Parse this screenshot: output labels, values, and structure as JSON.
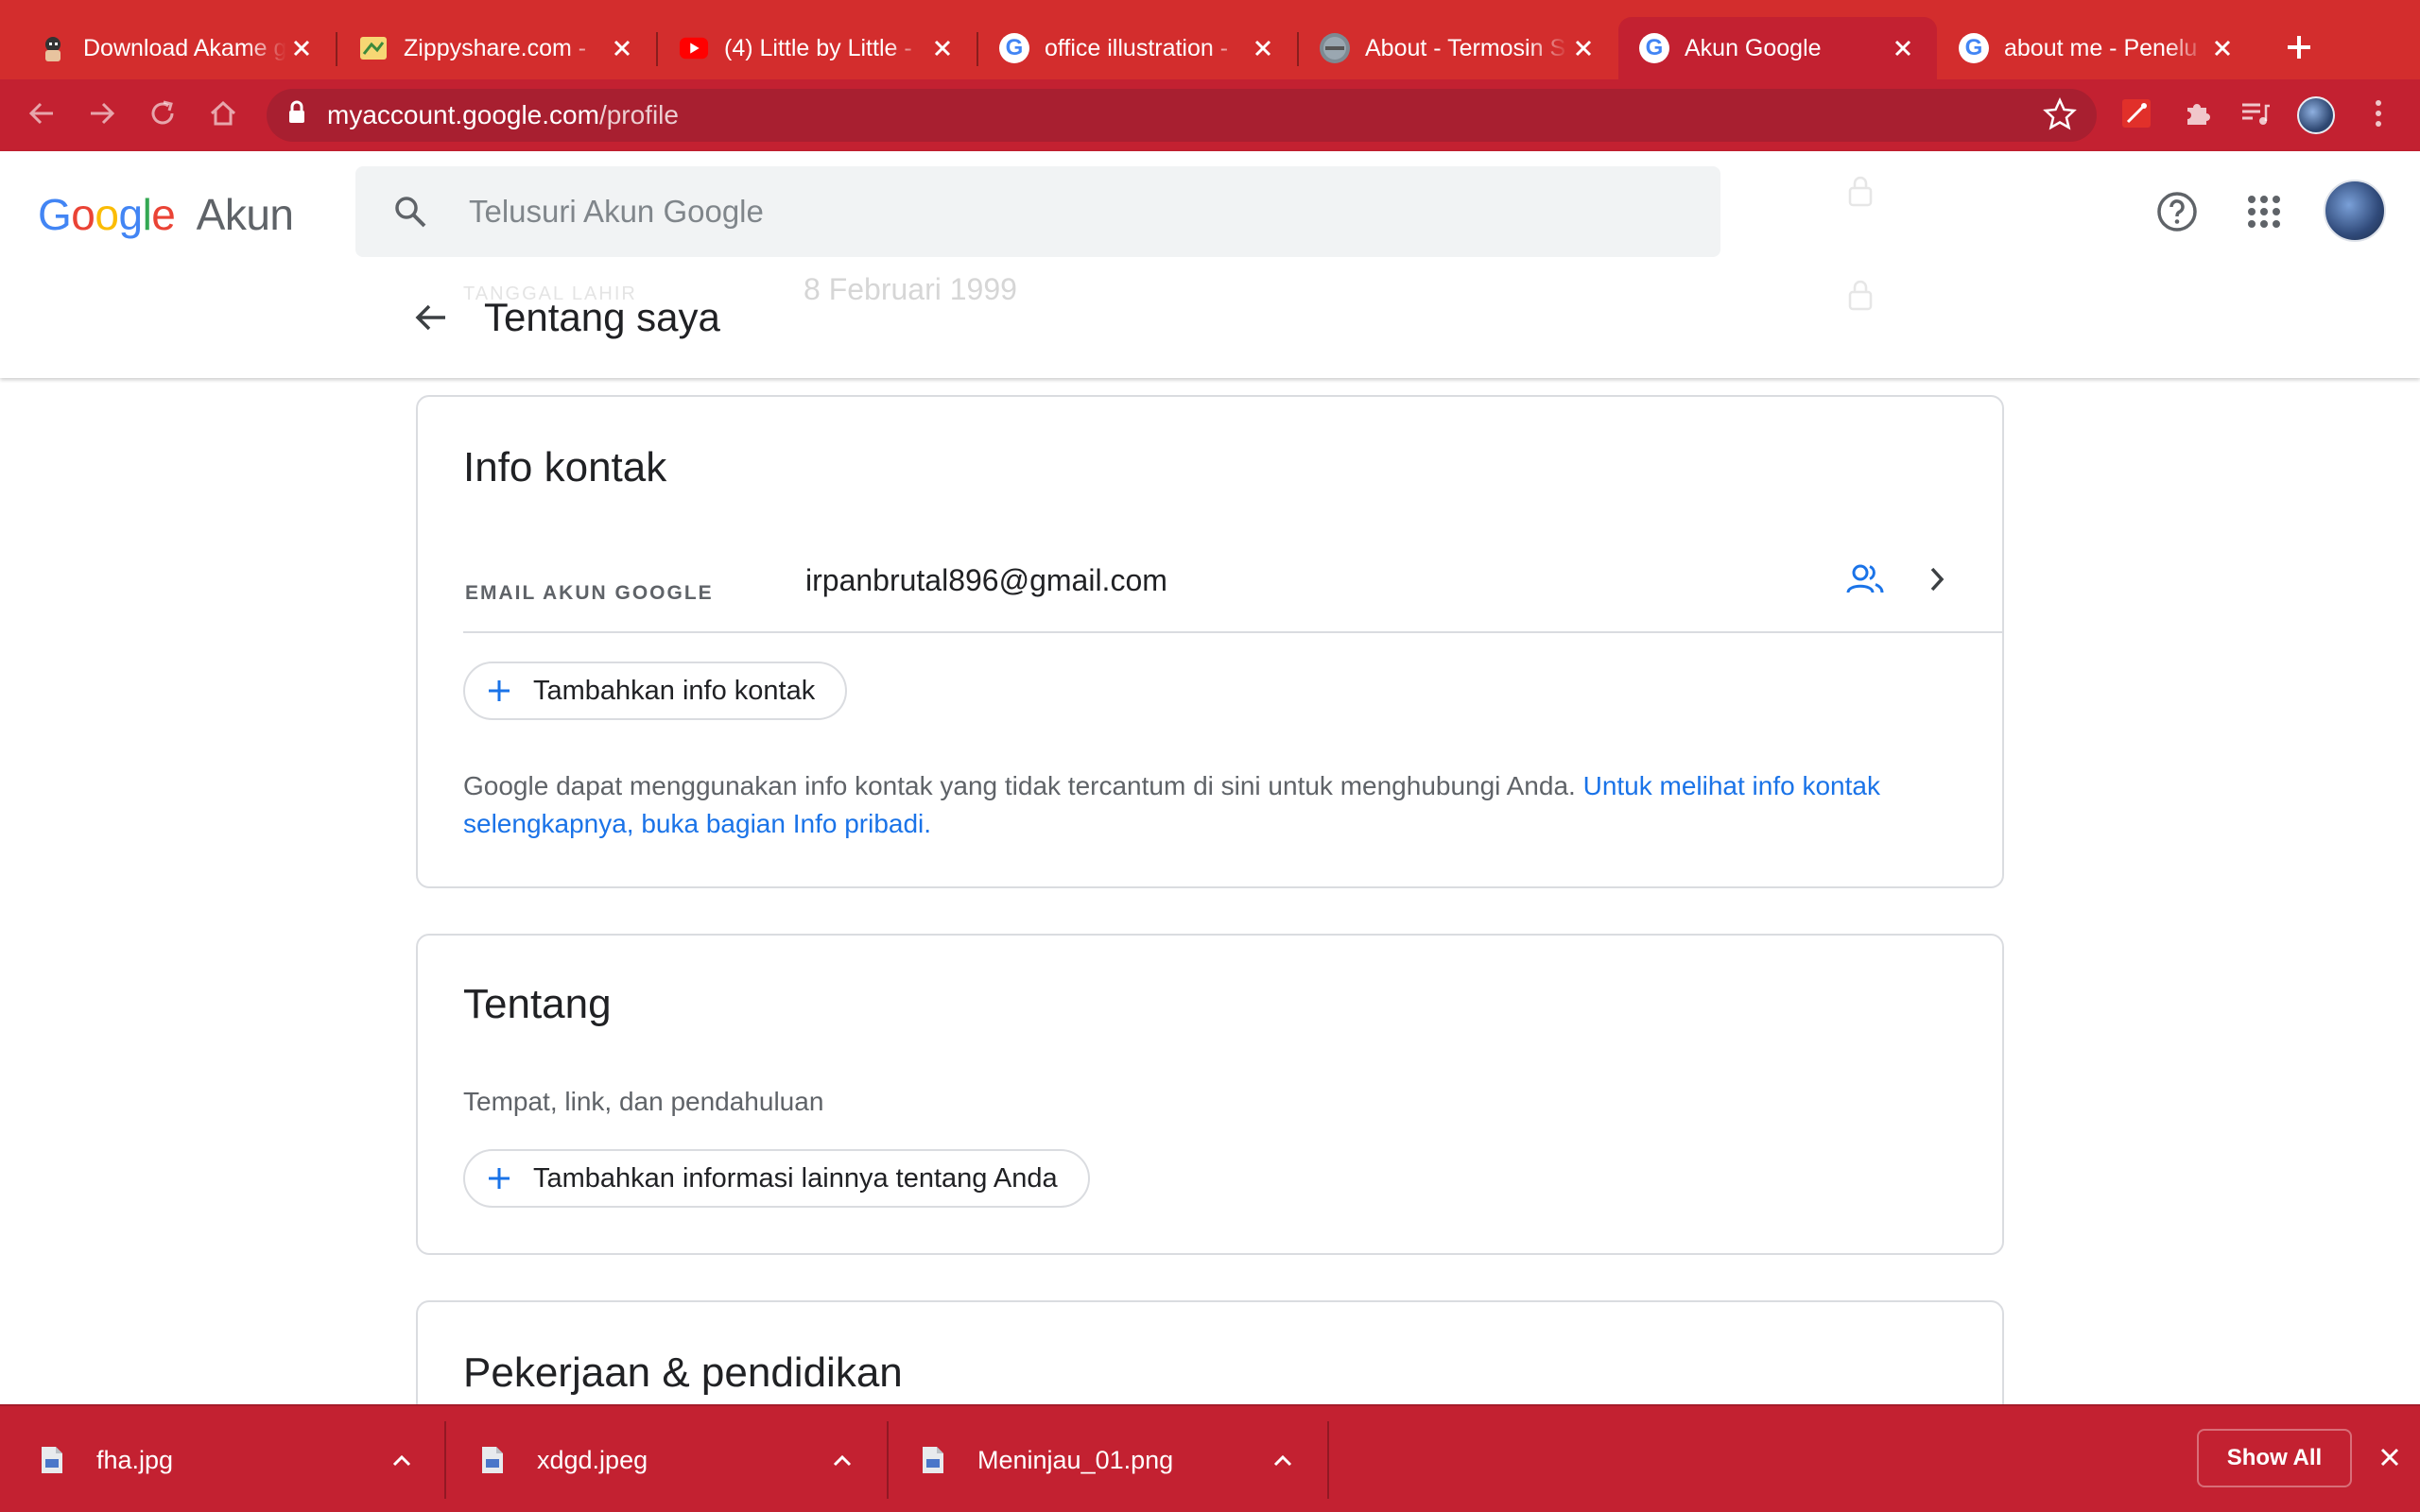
{
  "browser": {
    "tabs": [
      {
        "title": "Download Akame ga Kill",
        "favicon": "anime-icon",
        "active": false
      },
      {
        "title": "Zippyshare.com - ",
        "favicon": "zippy-icon",
        "active": false
      },
      {
        "title": "(4) Little by Little - ",
        "favicon": "youtube-icon",
        "active": false
      },
      {
        "title": "office illustration - ",
        "favicon": "google-icon",
        "active": false
      },
      {
        "title": "About - Termosin S",
        "favicon": "site-icon",
        "active": false
      },
      {
        "title": "Akun Google",
        "favicon": "google-icon",
        "active": true
      },
      {
        "title": "about me - Penelu",
        "favicon": "google-icon",
        "active": false
      }
    ],
    "url_host": "myaccount.google.com",
    "url_path": "/profile",
    "theme_color": "#c32131"
  },
  "header": {
    "logo_google": "Google",
    "logo_product": "Akun",
    "search_placeholder": "Telusuri Akun Google",
    "ghost_label": "TANGGAL LAHIR",
    "ghost_value": "8 Februari 1999",
    "page_title": "Tentang saya"
  },
  "contact_card": {
    "title": "Info kontak",
    "email_label": "EMAIL AKUN GOOGLE",
    "email_value": "irpanbrutal896@gmail.com",
    "add_button": "Tambahkan info kontak",
    "note_text": "Google dapat menggunakan info kontak yang tidak tercantum di sini untuk menghubungi Anda. ",
    "note_link": "Untuk melihat info kontak selengkapnya, buka bagian Info pribadi."
  },
  "about_card": {
    "title": "Tentang",
    "subtitle": "Tempat, link, dan pendahuluan",
    "add_button": "Tambahkan informasi lainnya tentang Anda"
  },
  "work_card": {
    "title": "Pekerjaan & pendidikan"
  },
  "downloads": {
    "items": [
      {
        "filename": "fha.jpg"
      },
      {
        "filename": "xdgd.jpeg"
      },
      {
        "filename": "Meninjau_01.png"
      }
    ],
    "show_all": "Show All"
  }
}
